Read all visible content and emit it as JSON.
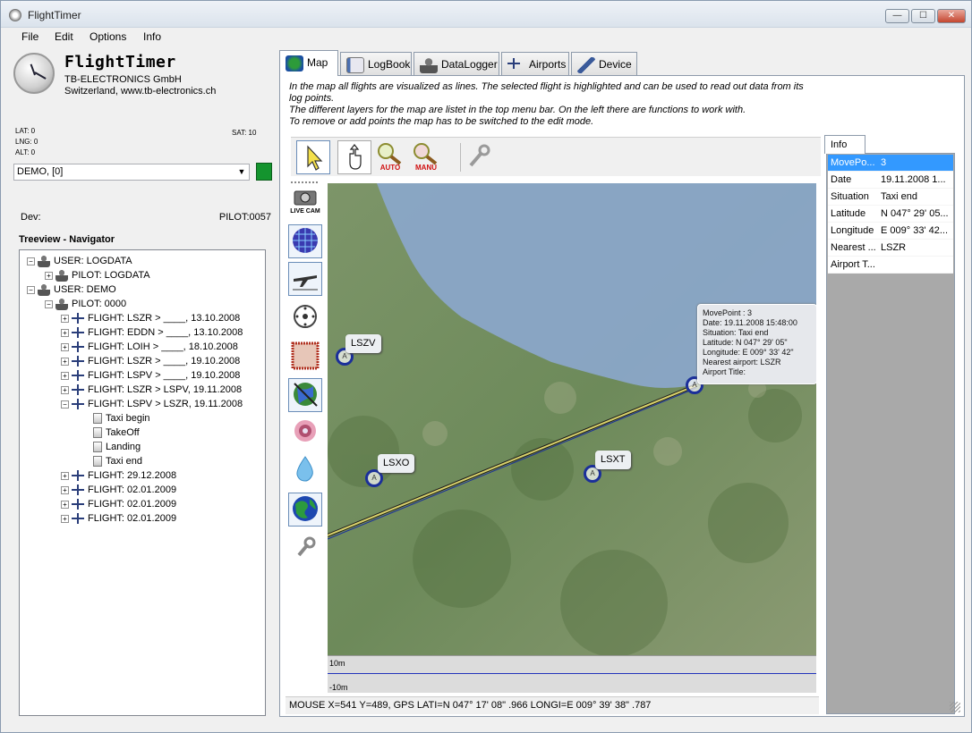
{
  "window": {
    "title": "FlightTimer",
    "min": "—",
    "max": "☐",
    "close": "✕"
  },
  "menu": [
    "File",
    "Edit",
    "Options",
    "Info"
  ],
  "brand": {
    "name": "FlightTimer",
    "company": "TB-ELECTRONICS GmbH",
    "address": "Switzerland, www.tb-electronics.ch"
  },
  "gps": {
    "lat": "LAT: 0",
    "lng": "LNG: 0",
    "alt": "ALT: 0",
    "sat": "SAT: 10"
  },
  "device_select": {
    "value": "DEMO, [0]"
  },
  "dev_label": "Dev:",
  "pilot_id": "PILOT:0057",
  "tree": {
    "title": "Treeview - Navigator",
    "nodes": [
      {
        "label": "USER: LOGDATA",
        "exp": "−"
      },
      {
        "label": "PILOT: LOGDATA",
        "exp": "+"
      },
      {
        "label": "USER: DEMO",
        "exp": "−"
      },
      {
        "label": "PILOT: 0000",
        "exp": "−"
      },
      {
        "label": "FLIGHT: LSZR > ____, 13.10.2008",
        "exp": "+"
      },
      {
        "label": "FLIGHT: EDDN > ____, 13.10.2008",
        "exp": "+"
      },
      {
        "label": "FLIGHT: LOIH > ____, 18.10.2008",
        "exp": "+"
      },
      {
        "label": "FLIGHT: LSZR > ____, 19.10.2008",
        "exp": "+"
      },
      {
        "label": "FLIGHT: LSPV > ____, 19.10.2008",
        "exp": "+"
      },
      {
        "label": "FLIGHT: LSZR > LSPV, 19.11.2008",
        "exp": "+"
      },
      {
        "label": "FLIGHT: LSPV > LSZR, 19.11.2008",
        "exp": "−"
      },
      {
        "label": "Taxi begin"
      },
      {
        "label": "TakeOff"
      },
      {
        "label": "Landing"
      },
      {
        "label": "Taxi end"
      },
      {
        "label": "FLIGHT: 29.12.2008",
        "exp": "+"
      },
      {
        "label": "FLIGHT: 02.01.2009",
        "exp": "+"
      },
      {
        "label": "FLIGHT: 02.01.2009",
        "exp": "+"
      },
      {
        "label": "FLIGHT: 02.01.2009",
        "exp": "+"
      }
    ]
  },
  "tabs": [
    "Map",
    "LogBook",
    "DataLogger",
    "Airports",
    "Device"
  ],
  "description": [
    "In the map all flights are visualized as lines. The selected flight is highlighted and can be used to read out data from its log points.",
    "The different layers for the map are listet in the top menu bar. On the left there are functions to work with.",
    "To remove or add points the map has to be switched to the edit mode."
  ],
  "toolbar": {
    "auto": "AUTO",
    "manu": "MANU"
  },
  "sidebar": {
    "livecam": "LIVE CAM"
  },
  "map": {
    "airports": [
      {
        "code": "LSZV",
        "id": "lszv"
      },
      {
        "code": "LSXO",
        "id": "lsxo"
      },
      {
        "code": "LSXT",
        "id": "lsxt"
      }
    ],
    "tooltip": [
      "MovePoint : 3",
      "Date: 19.11.2008 15:48:00",
      "Situation: Taxi end",
      "Latitude: N 047° 29' 05\"",
      "Longitude: E 009° 33' 42\"",
      "Nearest airport: LSZR",
      "Airport Title:"
    ],
    "marker_letter": "A",
    "colors": {
      "lake": "#8aa6c8",
      "track": "#d9d26a",
      "selected": "#1b2f9a"
    }
  },
  "elevation": {
    "top": "10m",
    "bottom": "-10m"
  },
  "status": "MOUSE X=541 Y=489, GPS LATI=N 047° 17' 08\" .966 LONGI=E 009° 39' 38\" .787",
  "info": {
    "tab": "Info",
    "rows": [
      {
        "k": "MovePo...",
        "v": "3"
      },
      {
        "k": "Date",
        "v": "19.11.2008 1..."
      },
      {
        "k": "Situation",
        "v": "Taxi end"
      },
      {
        "k": "Latitude",
        "v": "N 047° 29' 05..."
      },
      {
        "k": "Longitude",
        "v": "E 009° 33' 42..."
      },
      {
        "k": "Nearest ...",
        "v": "LSZR"
      },
      {
        "k": "Airport T...",
        "v": ""
      }
    ]
  }
}
